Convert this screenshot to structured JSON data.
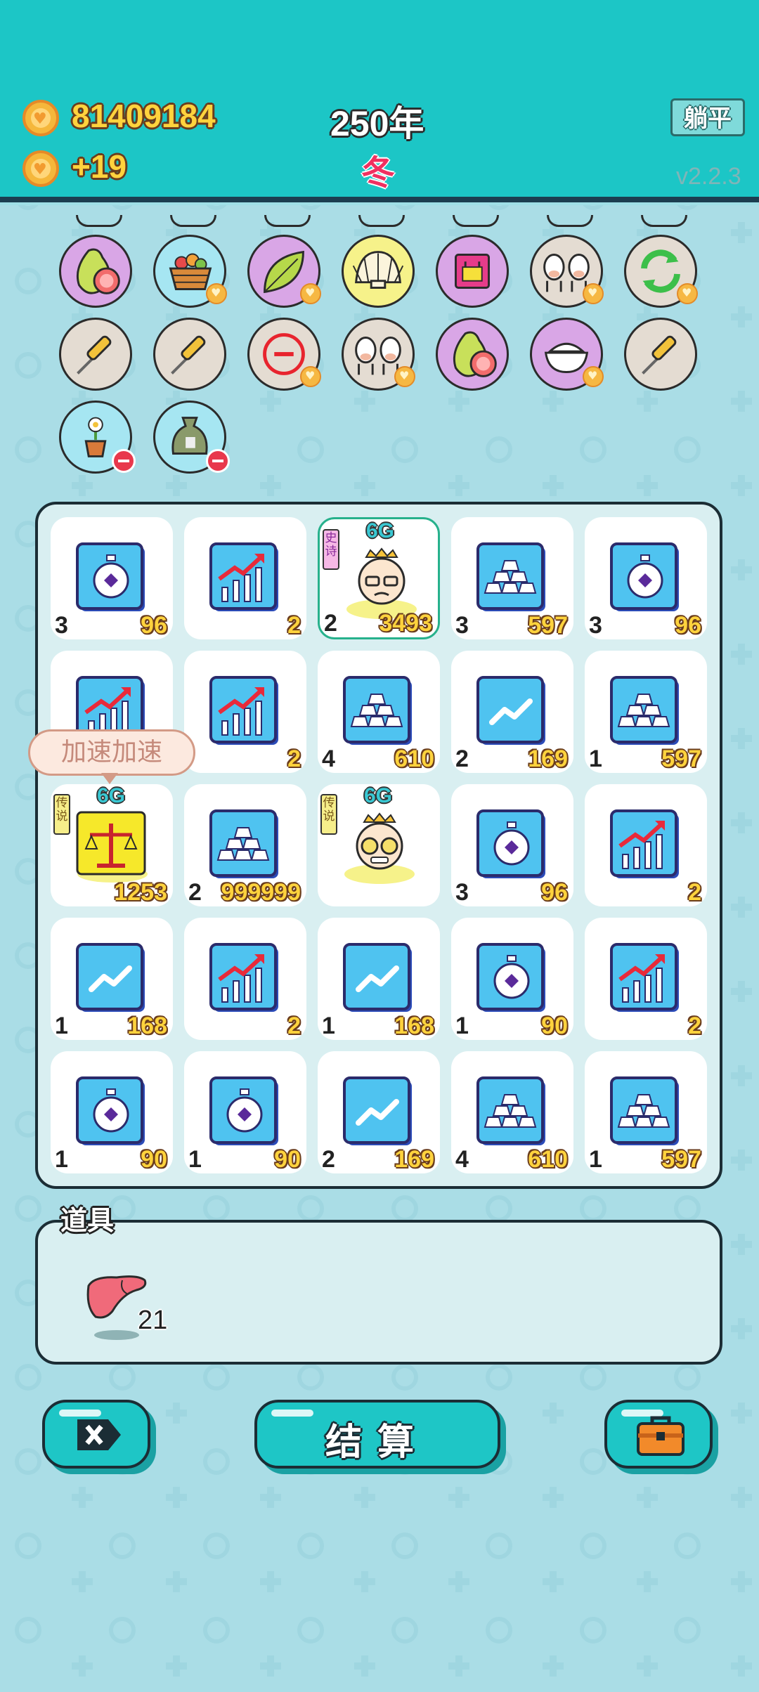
{
  "header": {
    "money": "81409184",
    "income": "+19",
    "year": "250年",
    "season": "冬",
    "lie_flat_label": "躺平",
    "version": "v2.2.3"
  },
  "item_circles": [
    {
      "icon": "pomelo-icon",
      "color": "#d9a6e6",
      "badge": "none"
    },
    {
      "icon": "fruit-basket-icon",
      "color": "#a6e6f2",
      "badge": "heart"
    },
    {
      "icon": "leaf-icon",
      "color": "#d9a6e6",
      "badge": "heart"
    },
    {
      "icon": "shell-icon",
      "color": "#f6f28a",
      "badge": "none"
    },
    {
      "icon": "pink-box-icon",
      "color": "#d9a6e6",
      "badge": "none"
    },
    {
      "icon": "cows-icon",
      "color": "#e4dcd2",
      "badge": "heart"
    },
    {
      "icon": "refresh-icon",
      "color": "#e4dcd2",
      "badge": "heart"
    },
    {
      "icon": "screwdriver-icon",
      "color": "#e4dcd2",
      "badge": "none"
    },
    {
      "icon": "screwdriver-icon",
      "color": "#e4dcd2",
      "badge": "none"
    },
    {
      "icon": "no-entry-icon",
      "color": "#e4dcd2",
      "badge": "heart"
    },
    {
      "icon": "cows-icon",
      "color": "#e4dcd2",
      "badge": "heart"
    },
    {
      "icon": "pomelo-icon",
      "color": "#d9a6e6",
      "badge": "none"
    },
    {
      "icon": "rice-bowl-icon",
      "color": "#d9a6e6",
      "badge": "heart"
    },
    {
      "icon": "screwdriver-icon",
      "color": "#e4dcd2",
      "badge": "none"
    },
    {
      "icon": "flower-pot-icon",
      "color": "#a6e6f2",
      "badge": "minus"
    },
    {
      "icon": "sack-icon",
      "color": "#a6e6f2",
      "badge": "minus"
    }
  ],
  "grid": [
    [
      {
        "icon": "stopwatch",
        "level": "3",
        "value": "96"
      },
      {
        "icon": "growth",
        "level": "",
        "value": "2"
      },
      {
        "icon": "old-man",
        "level": "2",
        "value": "3493",
        "tag": "6G",
        "rarity": "史诗"
      },
      {
        "icon": "gold",
        "level": "3",
        "value": "597"
      },
      {
        "icon": "stopwatch",
        "level": "3",
        "value": "96"
      }
    ],
    [
      {
        "icon": "growth",
        "level": "",
        "value": ""
      },
      {
        "icon": "growth",
        "level": "",
        "value": "2"
      },
      {
        "icon": "gold",
        "level": "4",
        "value": "610"
      },
      {
        "icon": "trend",
        "level": "2",
        "value": "169"
      },
      {
        "icon": "gold",
        "level": "1",
        "value": "597"
      }
    ],
    [
      {
        "icon": "scale",
        "level": "",
        "value": "1253",
        "tag": "6G",
        "rarity": "传说"
      },
      {
        "icon": "gold",
        "level": "2",
        "value": "999999"
      },
      {
        "icon": "glasses-man",
        "level": "",
        "value": "",
        "tag": "6G",
        "rarity": "传说"
      },
      {
        "icon": "stopwatch",
        "level": "3",
        "value": "96"
      },
      {
        "icon": "growth",
        "level": "",
        "value": "2"
      }
    ],
    [
      {
        "icon": "trend",
        "level": "1",
        "value": "168"
      },
      {
        "icon": "growth",
        "level": "",
        "value": "2"
      },
      {
        "icon": "trend",
        "level": "1",
        "value": "168"
      },
      {
        "icon": "stopwatch",
        "level": "1",
        "value": "90"
      },
      {
        "icon": "growth",
        "level": "",
        "value": "2"
      }
    ],
    [
      {
        "icon": "stopwatch",
        "level": "1",
        "value": "90"
      },
      {
        "icon": "stopwatch",
        "level": "1",
        "value": "90"
      },
      {
        "icon": "trend",
        "level": "2",
        "value": "169"
      },
      {
        "icon": "gold",
        "level": "4",
        "value": "610"
      },
      {
        "icon": "gold",
        "level": "1",
        "value": "597"
      }
    ]
  ],
  "bubble_text": "加速加速",
  "items": {
    "title": "道具",
    "liver_count": "21"
  },
  "buttons": {
    "settle_label": "结算"
  },
  "colors": {
    "header": "#1cc6c6",
    "background": "#aadde6",
    "tile_blue": "#4fc3f0",
    "gold_text": "#ffd33d"
  }
}
